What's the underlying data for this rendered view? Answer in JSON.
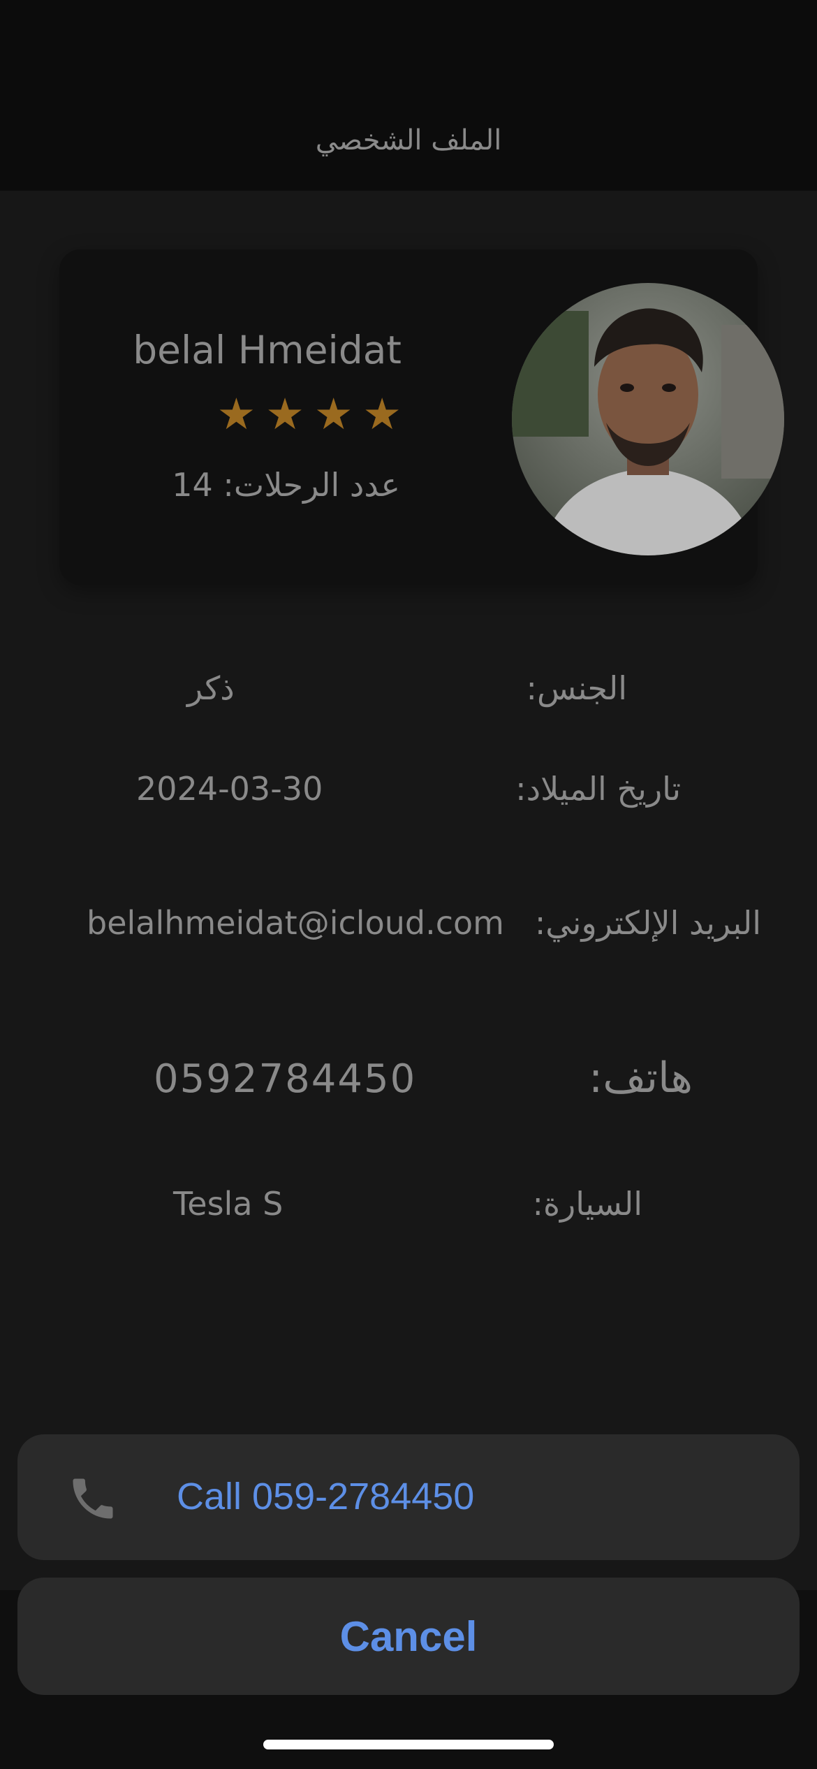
{
  "header": {
    "title": "الملف الشخصي"
  },
  "profile": {
    "name": "belal Hmeidat",
    "rating": 4,
    "stars": [
      "★",
      "★",
      "★",
      "★"
    ],
    "trips_text": "عدد الرحلات: 14"
  },
  "details": {
    "gender_label": "الجنس:",
    "gender_value": "ذكر",
    "birth_label": "تاريخ الميلاد:",
    "birth_value": "2024-03-30",
    "email_label": "البريد الإلكتروني:",
    "email_value": "belalhmeidat@icloud.com",
    "phone_label": "هاتف:",
    "phone_value": "0592784450",
    "car_label": "السيارة:",
    "car_value": "Tesla S"
  },
  "sheet": {
    "call_label": "Call 059-2784450",
    "cancel_label": "Cancel"
  },
  "colors": {
    "accent_blue": "#5d8fe6",
    "star_color": "#9a6a1f",
    "text_gray": "#8a8a8a",
    "background": "#171717"
  }
}
